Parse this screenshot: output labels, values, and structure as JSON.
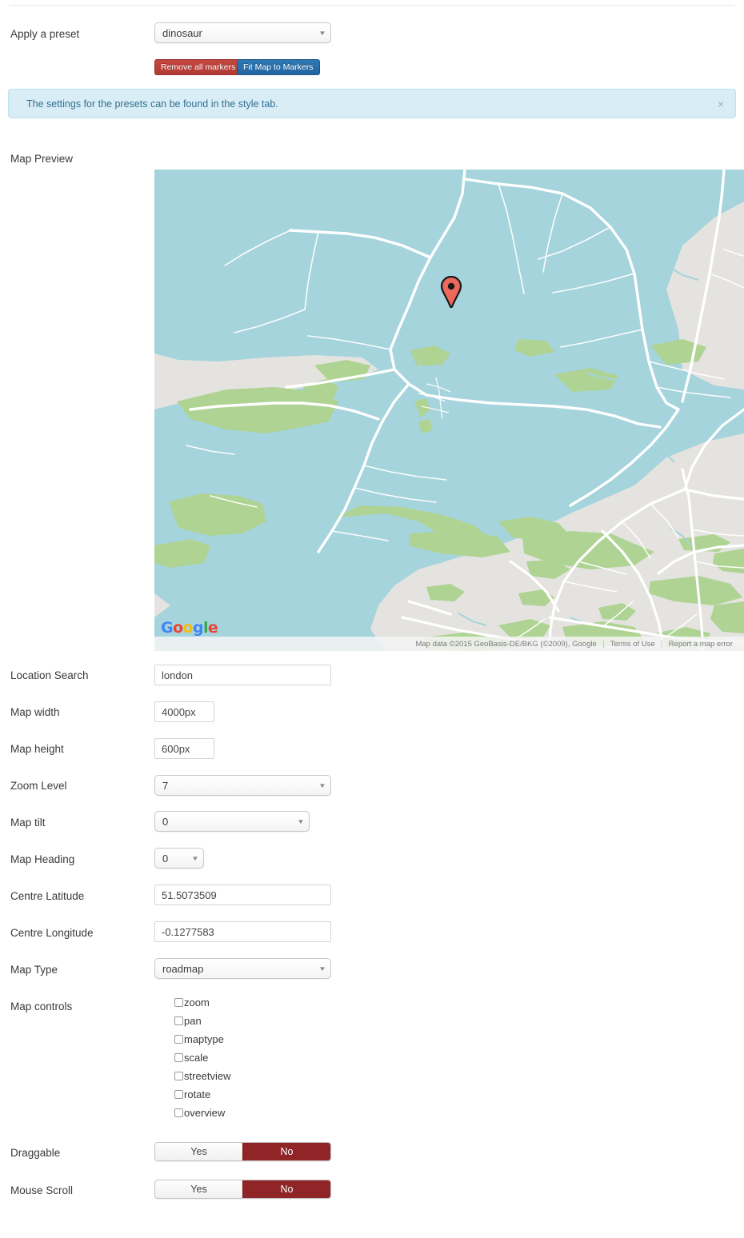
{
  "preset": {
    "label": "Apply a preset",
    "value": "dinosaur",
    "caret": "chevron-down-icon"
  },
  "buttons": {
    "remove_markers": "Remove all markers",
    "fit_map": "Fit Map to Markers"
  },
  "alert": {
    "message": "The settings for the presets can be found in the style tab.",
    "close": "×",
    "bg_color": "#d9edf7",
    "text_color": "#31708f"
  },
  "map_preview": {
    "label": "Map Preview",
    "logo": "Google",
    "logo_letters": [
      {
        "c": "G",
        "color": "#4285f4"
      },
      {
        "c": "o",
        "color": "#ea4335"
      },
      {
        "c": "o",
        "color": "#fbbc05"
      },
      {
        "c": "g",
        "color": "#4285f4"
      },
      {
        "c": "l",
        "color": "#34a853"
      },
      {
        "c": "e",
        "color": "#ea4335"
      }
    ],
    "attribution": "Map data ©2015 GeoBasis-DE/BKG (©2009), Google",
    "terms": "Terms of Use",
    "report": "Report a map error",
    "colors": {
      "land": "#e4e3df",
      "water": "#a5d4dc",
      "park": "#aed392",
      "road": "#ffffff",
      "marker": "#eb6a5c"
    }
  },
  "fields": {
    "location_search": {
      "label": "Location Search",
      "value": "london"
    },
    "map_width": {
      "label": "Map width",
      "value": "4000px"
    },
    "map_height": {
      "label": "Map height",
      "value": "600px"
    },
    "zoom_level": {
      "label": "Zoom Level",
      "value": "7"
    },
    "map_tilt": {
      "label": "Map tilt",
      "value": "0"
    },
    "map_heading": {
      "label": "Map Heading",
      "value": "0"
    },
    "centre_latitude": {
      "label": "Centre Latitude",
      "value": "51.5073509"
    },
    "centre_longitude": {
      "label": "Centre Longitude",
      "value": "-0.1277583"
    },
    "map_type": {
      "label": "Map Type",
      "value": "roadmap"
    }
  },
  "map_controls": {
    "label": "Map controls",
    "items": [
      {
        "label": "zoom",
        "checked": false
      },
      {
        "label": "pan",
        "checked": false
      },
      {
        "label": "maptype",
        "checked": false
      },
      {
        "label": "scale",
        "checked": false
      },
      {
        "label": "streetview",
        "checked": false
      },
      {
        "label": "rotate",
        "checked": false
      },
      {
        "label": "overview",
        "checked": false
      }
    ]
  },
  "toggles": {
    "draggable": {
      "label": "Draggable",
      "yes": "Yes",
      "no": "No",
      "selected": "No"
    },
    "mouse_scroll": {
      "label": "Mouse Scroll",
      "yes": "Yes",
      "no": "No",
      "selected": "No"
    }
  }
}
